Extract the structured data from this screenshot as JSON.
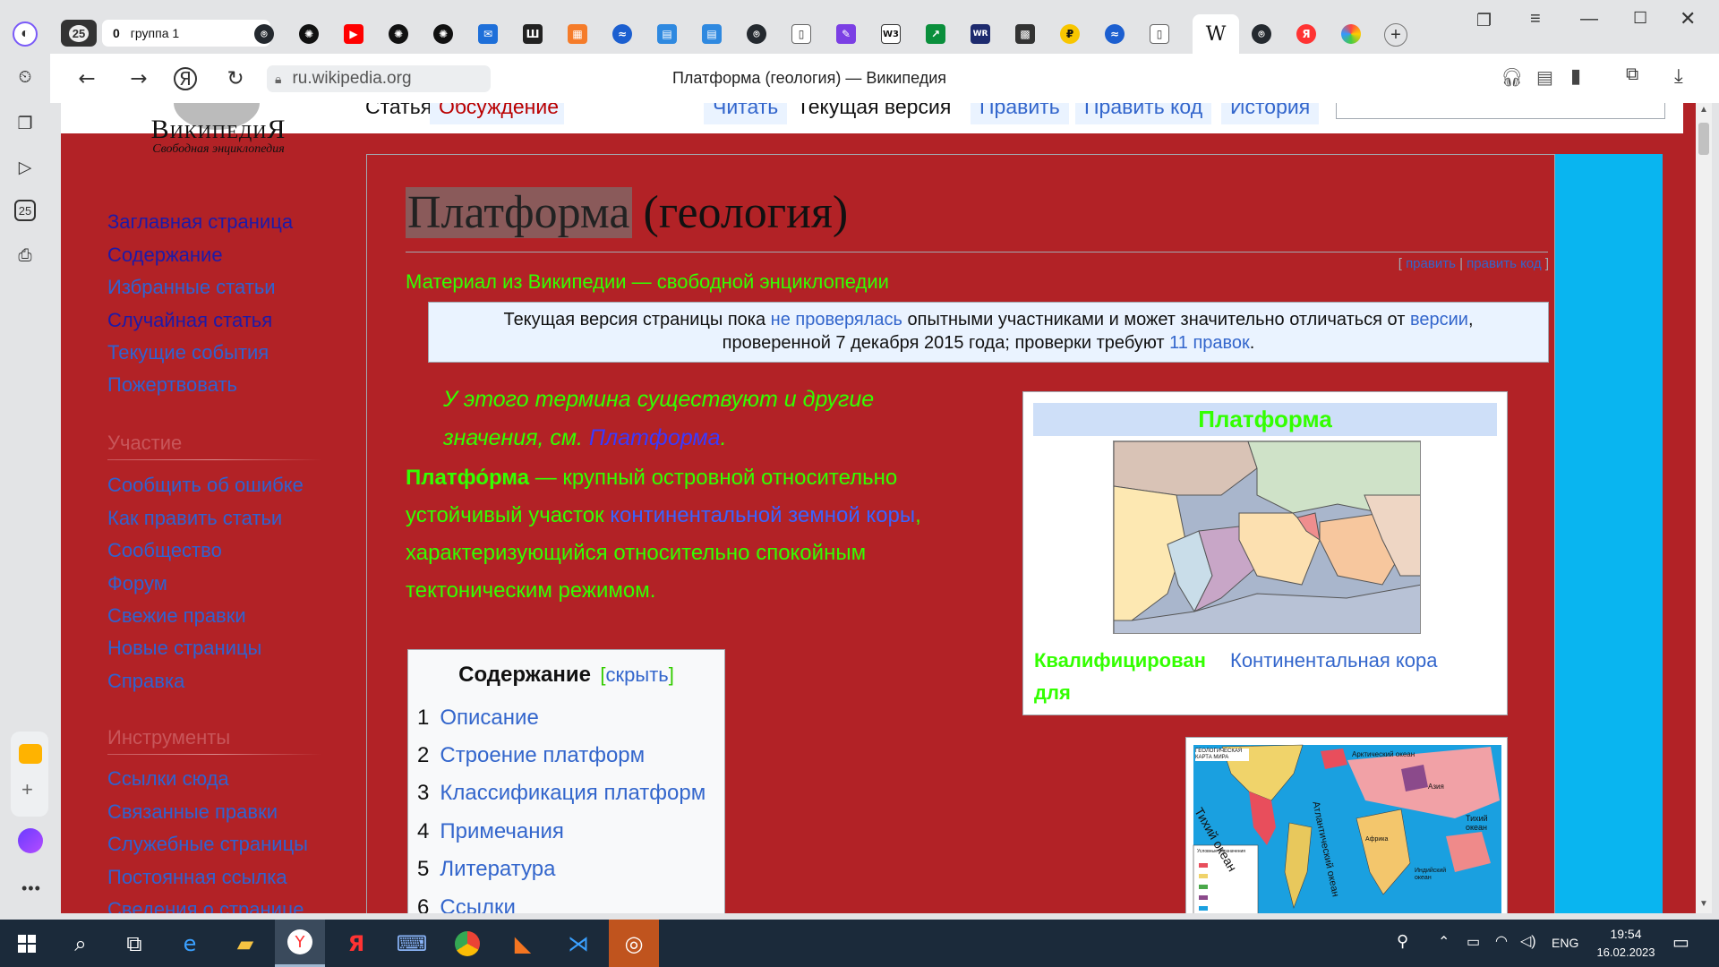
{
  "tabs": {
    "count": "25",
    "group_count": "0",
    "group_label": "группа 1"
  },
  "address": {
    "domain": "ru.wikipedia.org",
    "title": "Платформа (геология) — Википедия"
  },
  "wiki": {
    "logo_name": "ВикипедиЯ",
    "logo_sub": "Свободная энциклопедия",
    "tabs": [
      "Статья",
      "Обсуждение",
      "Читать",
      "Текущая версия",
      "Править",
      "Править код",
      "История"
    ],
    "nav": [
      "Заглавная страница",
      "Содержание",
      "Избранные статьи",
      "Случайная статья",
      "Текущие события",
      "Пожертвовать"
    ],
    "section_participation": "Участие",
    "participation": [
      "Сообщить об ошибке",
      "Как править статьи",
      "Сообщество",
      "Форум",
      "Свежие правки",
      "Новые страницы",
      "Справка"
    ],
    "section_tools": "Инструменты",
    "tools": [
      "Ссылки сюда",
      "Связанные правки",
      "Служебные страницы",
      "Постоянная ссылка",
      "Сведения о странице"
    ],
    "title_highlight": "Платформа",
    "title_rest": " (геология)",
    "edit_link": "править",
    "edit_code_link": "править код",
    "subtitle": "Материал из Википедии — свободной энциклопедии",
    "notice": {
      "p1": "Текущая версия страницы пока ",
      "link1": "не проверялась",
      "p2": " опытными участниками и может значительно отличаться от ",
      "link2": "версии",
      "p3": ", проверенной 7 декабря 2015 года; проверки требуют ",
      "link3": "11 правок",
      "p4": "."
    },
    "hatnote": {
      "text": "У этого термина существуют и другие значения, см. ",
      "link": "Платформа",
      "end": "."
    },
    "lead": {
      "bold": "Платфо́рма",
      "t1": " — крупный островной относительно устойчивый участок ",
      "link": "континентальной земной коры",
      "t2": ", характеризующийся относительно спокойным тектоническим режимом."
    },
    "toc": {
      "title": "Содержание",
      "hide_open": "[",
      "hide": "скрыть",
      "hide_close": "]",
      "items": [
        {
          "n": "1",
          "t": "Описание"
        },
        {
          "n": "2",
          "t": "Строение платформ"
        },
        {
          "n": "3",
          "t": "Классификация платформ"
        },
        {
          "n": "4",
          "t": "Примечания"
        },
        {
          "n": "5",
          "t": "Литература"
        },
        {
          "n": "6",
          "t": "Ссылки"
        }
      ]
    },
    "infobox": {
      "title": "Платформа",
      "row_label": "Квалифицирован для",
      "row_value": "Континентальная кора"
    },
    "map2_labels": {
      "title": "ГЕОЛОГИЧЕСКАЯ КАРТА МИРА",
      "arctic": "Арктический океан",
      "pacific": "Тихий океан",
      "atlantic": "Атлантический океан",
      "pacific_right": "Тихий океан",
      "indian": "Индийский океан",
      "africa": "Африка",
      "asia": "Азия",
      "legend": "Условные обозначения"
    }
  },
  "taskbar": {
    "lang": "ENG",
    "time": "19:54",
    "date": "16.02.2023"
  },
  "colors": {
    "page_bg": "#b22226",
    "green_text": "#33ff00",
    "cyan": "#09b5f0",
    "link": "#3366cc"
  }
}
